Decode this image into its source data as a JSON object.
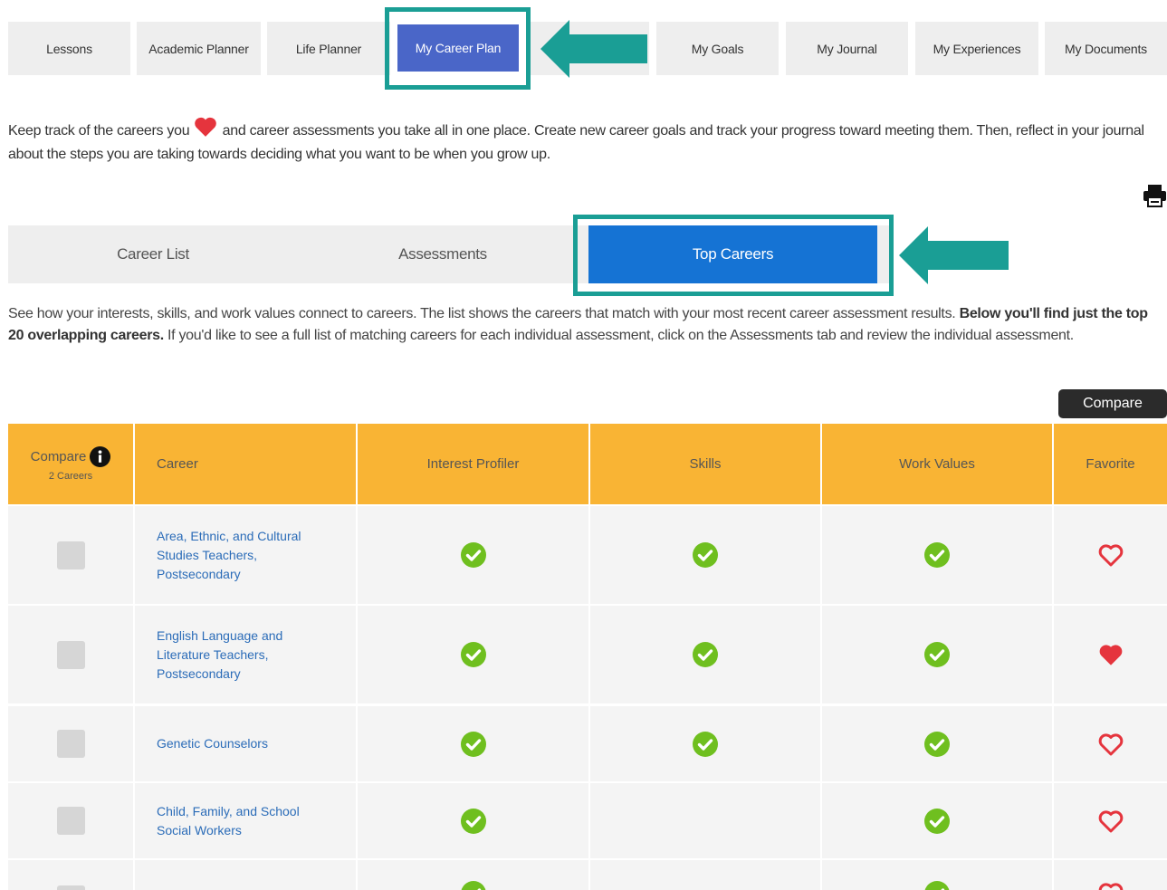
{
  "nav": {
    "tabs": [
      {
        "label": "Lessons"
      },
      {
        "label": "Academic Planner"
      },
      {
        "label": "Life Planner"
      },
      {
        "label": "My Career Plan"
      },
      {
        "label": "My Goals"
      },
      {
        "label": "My Journal"
      },
      {
        "label": "My Experiences"
      },
      {
        "label": "My Documents"
      }
    ]
  },
  "intro": {
    "before_heart": "Keep track of the careers you",
    "after_heart": "and career assessments you take all in one place. Create new career goals and track your progress toward meeting them. Then, reflect in your journal about the steps you are taking towards deciding what you want to be when you grow up."
  },
  "subtabs": [
    {
      "label": "Career List"
    },
    {
      "label": "Assessments"
    },
    {
      "label": "Top Careers"
    }
  ],
  "description": {
    "part1": "See how your interests, skills, and work values connect to careers. The list shows the careers that match with your most recent career assessment results. ",
    "bold": "Below you'll find just the top 20 overlapping careers.",
    "part2": " If you'd like to see a full list of matching careers for each individual assessment, click on the Assessments tab and review the individual assessment."
  },
  "compare_button": "Compare",
  "table": {
    "headers": {
      "compare": "Compare",
      "compare_count": "2 Careers",
      "career": "Career",
      "interest": "Interest Profiler",
      "skills": "Skills",
      "values": "Work Values",
      "favorite": "Favorite"
    },
    "rows": [
      {
        "career": "Area, Ethnic, and Cultural Studies Teachers, Postsecondary",
        "interest": true,
        "skills": true,
        "values": true,
        "favorite": false
      },
      {
        "career": "English Language and Literature Teachers, Postsecondary",
        "interest": true,
        "skills": true,
        "values": true,
        "favorite": true
      },
      {
        "career": "Genetic Counselors",
        "interest": true,
        "skills": true,
        "values": true,
        "favorite": false
      },
      {
        "career": "Child, Family, and School Social Workers",
        "interest": true,
        "skills": false,
        "values": true,
        "favorite": false
      },
      {
        "career": "",
        "interest": true,
        "skills": false,
        "values": true,
        "favorite": false
      }
    ]
  },
  "colors": {
    "highlight": "#1a9e95",
    "header": "#f9b434",
    "check": "#6fbf1f",
    "heart": "#e5343d",
    "active_tab": "#4a66c8",
    "active_subtab": "#1573d4"
  }
}
